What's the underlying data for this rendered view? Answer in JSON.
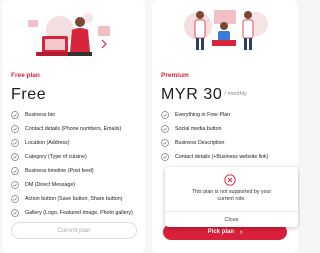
{
  "colors": {
    "accent": "#d9203a",
    "check": "#7c7c7c",
    "error_icon": "#d9203a"
  },
  "free": {
    "plan_label": "Free plan",
    "price": "Free",
    "features": [
      "Business bio",
      "Contact details (Phone numbers, Emails)",
      "Location (Address)",
      "Category (Type of cuisine)",
      "Business timeline (Post feed)",
      "DM (Direct Message)",
      "Action button (Save button, Share button)",
      "Gallery (Logo, Featured Image, Photo gallery)"
    ],
    "button_label": "Current plan"
  },
  "premium": {
    "plan_label": "Premium",
    "price": "MYR 30",
    "period": "/ monthly",
    "features": [
      "Everything in Free Plan",
      "Social media button",
      "Business Description",
      "Contact details (+Business website link)"
    ],
    "button_label": "Pick plan",
    "button_icon": "chevron-right-icon"
  },
  "modal": {
    "icon": "error-circle-icon",
    "message_line1": "This plan is not supported by your",
    "message_line2": "current role.",
    "close_label": "Close"
  }
}
